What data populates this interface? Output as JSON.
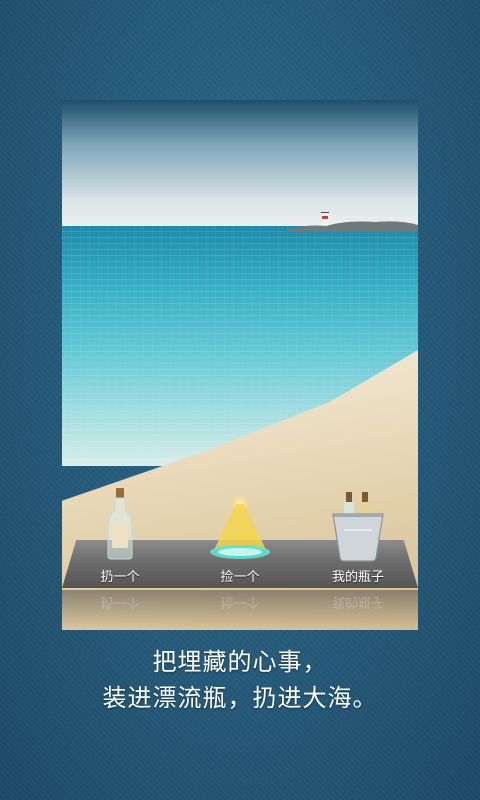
{
  "actions": {
    "throw": {
      "label": "扔一个",
      "icon": "bottle-icon"
    },
    "pick": {
      "label": "捡一个",
      "icon": "glowing-light-icon"
    },
    "mine": {
      "label": "我的瓶子",
      "icon": "ice-bucket-bottles-icon"
    }
  },
  "caption": {
    "line1": "把埋藏的心事，",
    "line2": "装进漂流瓶，扔进大海。"
  },
  "colors": {
    "background": "#245978",
    "sea": "#38aec4",
    "sand": "#e7d7b5",
    "glow": "#f3d64a"
  }
}
